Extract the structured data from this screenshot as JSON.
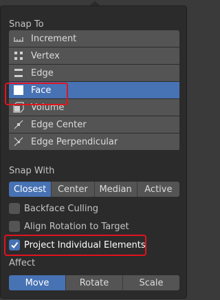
{
  "snap_to": {
    "heading": "Snap To",
    "items": [
      {
        "label": "Increment",
        "icon": "increment-icon"
      },
      {
        "label": "Vertex",
        "icon": "vertex-icon"
      },
      {
        "label": "Edge",
        "icon": "edge-icon"
      },
      {
        "label": "Face",
        "icon": "face-icon",
        "selected": true
      },
      {
        "label": "Volume",
        "icon": "volume-icon"
      },
      {
        "label": "Edge Center",
        "icon": "edge-center-icon"
      },
      {
        "label": "Edge Perpendicular",
        "icon": "edge-perpendicular-icon"
      }
    ]
  },
  "snap_with": {
    "heading": "Snap With",
    "options": [
      "Closest",
      "Center",
      "Median",
      "Active"
    ],
    "selected": "Closest"
  },
  "options": {
    "backface_culling": {
      "label": "Backface Culling",
      "checked": false
    },
    "align_rotation": {
      "label": "Align Rotation to Target",
      "checked": false
    },
    "project_individual": {
      "label": "Project Individual Elements",
      "checked": true
    }
  },
  "affect": {
    "heading": "Affect",
    "options": [
      "Move",
      "Rotate",
      "Scale"
    ],
    "selected": "Move"
  },
  "colors": {
    "accent": "#4772b3",
    "highlight": "#e0141e",
    "panel": "#2b2b2b",
    "button": "#545454"
  }
}
